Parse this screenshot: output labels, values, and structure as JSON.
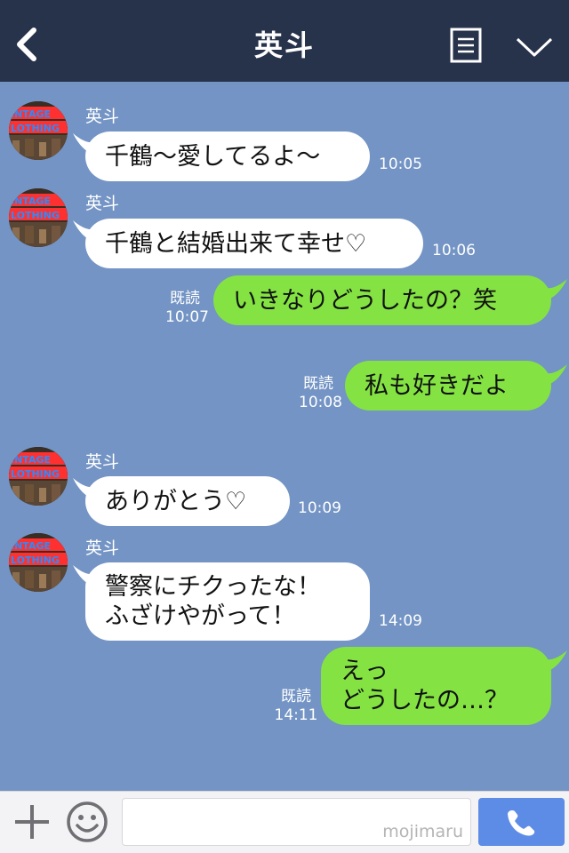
{
  "header": {
    "title": "英斗"
  },
  "messages": [
    {
      "side": "in",
      "sender": "英斗",
      "lines": [
        "千鶴〜愛してるよ〜"
      ],
      "time": "10:05"
    },
    {
      "side": "in",
      "sender": "英斗",
      "lines": [
        "千鶴と結婚出来て幸せ♡"
      ],
      "time": "10:06"
    },
    {
      "side": "out",
      "read": "既読",
      "lines": [
        "いきなりどうしたの？笑"
      ],
      "time": "10:07"
    },
    {
      "side": "out",
      "read": "既読",
      "lines": [
        "私も好きだよ"
      ],
      "time": "10:08"
    },
    {
      "side": "in",
      "sender": "英斗",
      "lines": [
        "ありがとう♡"
      ],
      "time": "10:09"
    },
    {
      "side": "in",
      "sender": "英斗",
      "lines": [
        "警察にチクったな！",
        "ふざけやがって！"
      ],
      "time": "14:09"
    },
    {
      "side": "out",
      "read": "既読",
      "lines": [
        "えっ",
        "どうしたの…？"
      ],
      "time": "14:11"
    }
  ],
  "avatar": {
    "line1": "INTAGE",
    "line2": "LOTHING"
  },
  "footer": {
    "input_value": "",
    "watermark": "mojimaru"
  },
  "colors": {
    "header": "#27324b",
    "chat_bg": "#7394c4",
    "outgoing": "#84e343",
    "incoming": "#ffffff",
    "send": "#5d8ce6"
  }
}
